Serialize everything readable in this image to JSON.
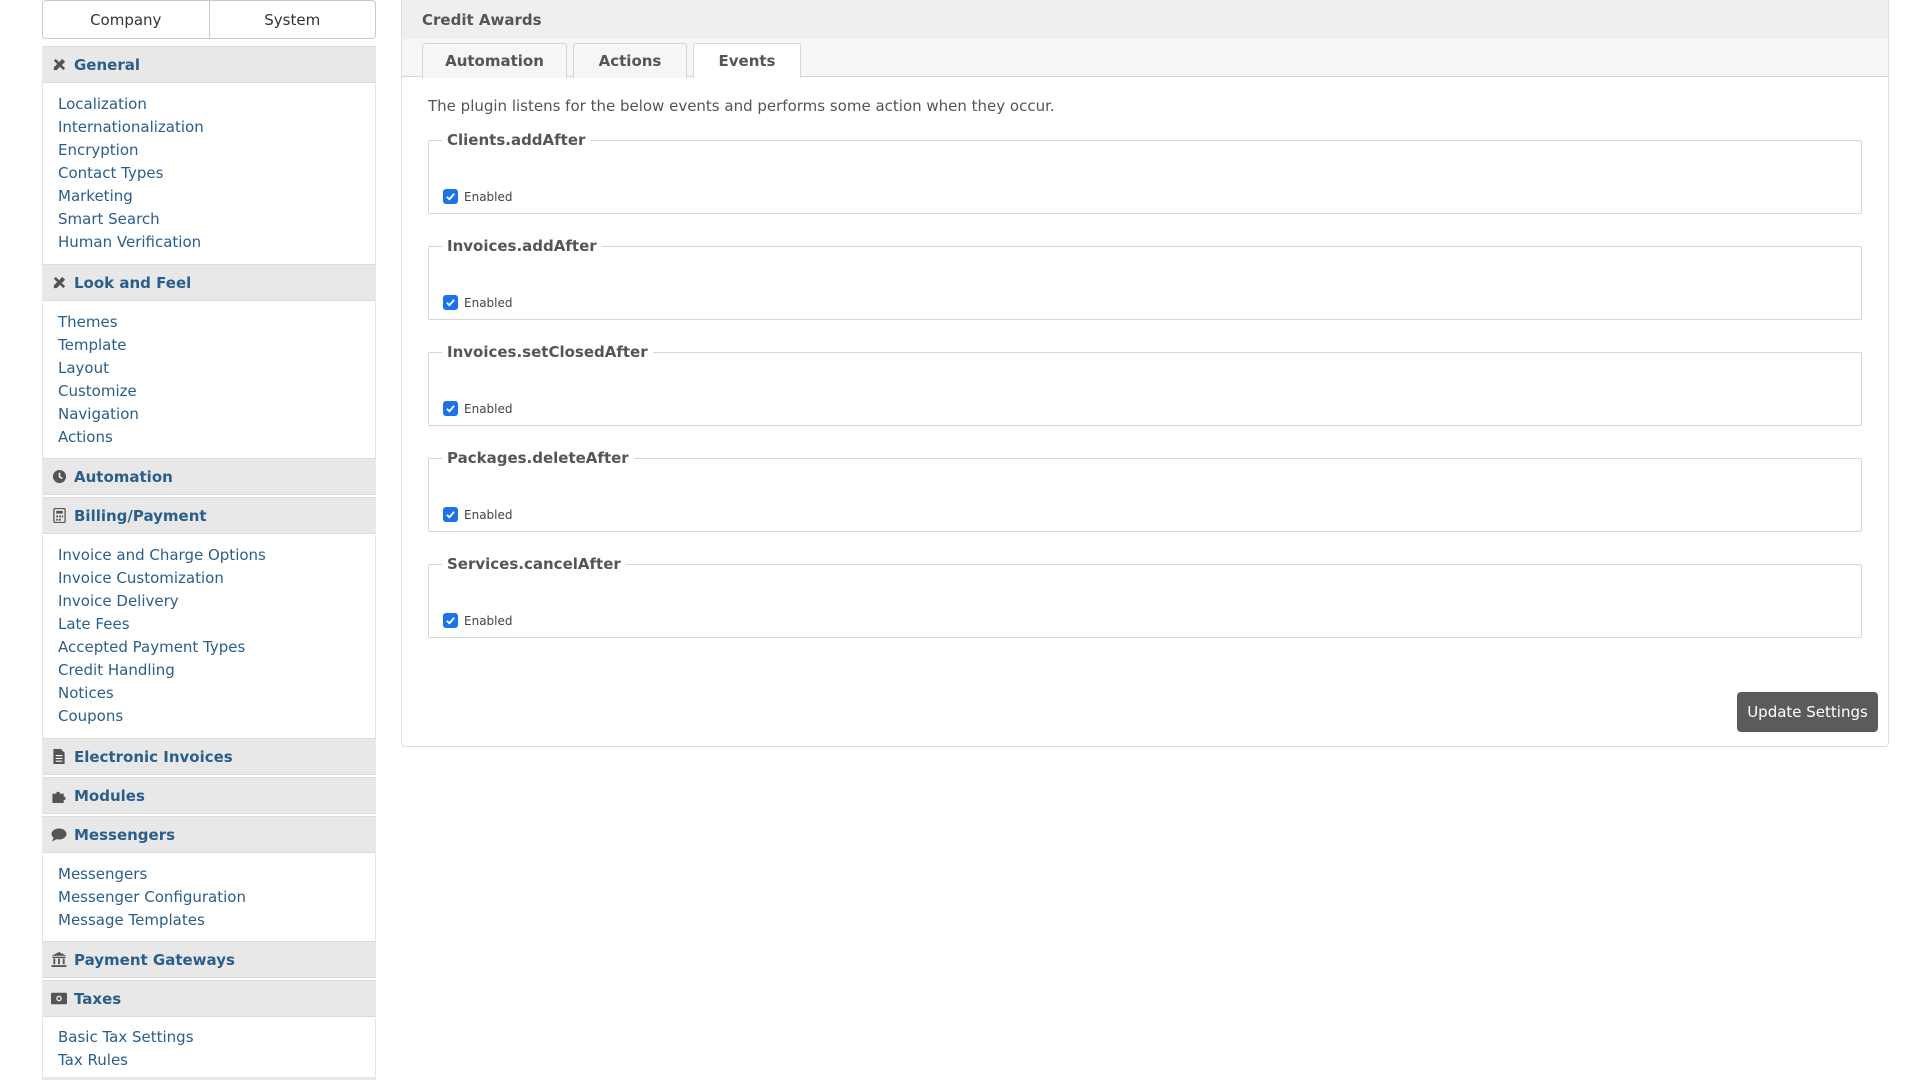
{
  "sidebar": {
    "toggle": {
      "company": "Company",
      "system": "System"
    },
    "sections": {
      "general": {
        "title": "General",
        "icon": "tools-icon",
        "items": [
          "Localization",
          "Internationalization",
          "Encryption",
          "Contact Types",
          "Marketing",
          "Smart Search",
          "Human Verification"
        ]
      },
      "look": {
        "title": "Look and Feel",
        "icon": "tools-icon",
        "items": [
          "Themes",
          "Template",
          "Layout",
          "Customize",
          "Navigation",
          "Actions"
        ]
      },
      "automation": {
        "title": "Automation",
        "icon": "clock-icon"
      },
      "billing": {
        "title": "Billing/Payment",
        "icon": "calculator-icon",
        "items": [
          "Invoice and Charge Options",
          "Invoice Customization",
          "Invoice Delivery",
          "Late Fees",
          "Accepted Payment Types",
          "Credit Handling",
          "Notices",
          "Coupons"
        ]
      },
      "einvoices": {
        "title": "Electronic Invoices",
        "icon": "document-icon"
      },
      "modules": {
        "title": "Modules",
        "icon": "puzzle-icon"
      },
      "messengers": {
        "title": "Messengers",
        "icon": "chat-icon",
        "items": [
          "Messengers",
          "Messenger Configuration",
          "Message Templates"
        ]
      },
      "gateways": {
        "title": "Payment Gateways",
        "icon": "bank-icon"
      },
      "taxes": {
        "title": "Taxes",
        "icon": "money-icon",
        "items": [
          "Basic Tax Settings",
          "Tax Rules"
        ]
      }
    }
  },
  "panel": {
    "title": "Credit Awards",
    "tabs": [
      "Automation",
      "Actions",
      "Events"
    ],
    "active_tab": "Events",
    "intro": "The plugin listens for the below events and performs some action when they occur.",
    "events": [
      {
        "name": "Clients.addAfter",
        "label": "Enabled",
        "checked": true
      },
      {
        "name": "Invoices.addAfter",
        "label": "Enabled",
        "checked": true
      },
      {
        "name": "Invoices.setClosedAfter",
        "label": "Enabled",
        "checked": true
      },
      {
        "name": "Packages.deleteAfter",
        "label": "Enabled",
        "checked": true
      },
      {
        "name": "Services.cancelAfter",
        "label": "Enabled",
        "checked": true
      }
    ],
    "submit_label": "Update Settings"
  },
  "colors": {
    "link": "#2a5e8c",
    "section_bg": "#e8e8e8",
    "button_bg": "#5b5b5b",
    "checkbox": "#1a73e8"
  }
}
